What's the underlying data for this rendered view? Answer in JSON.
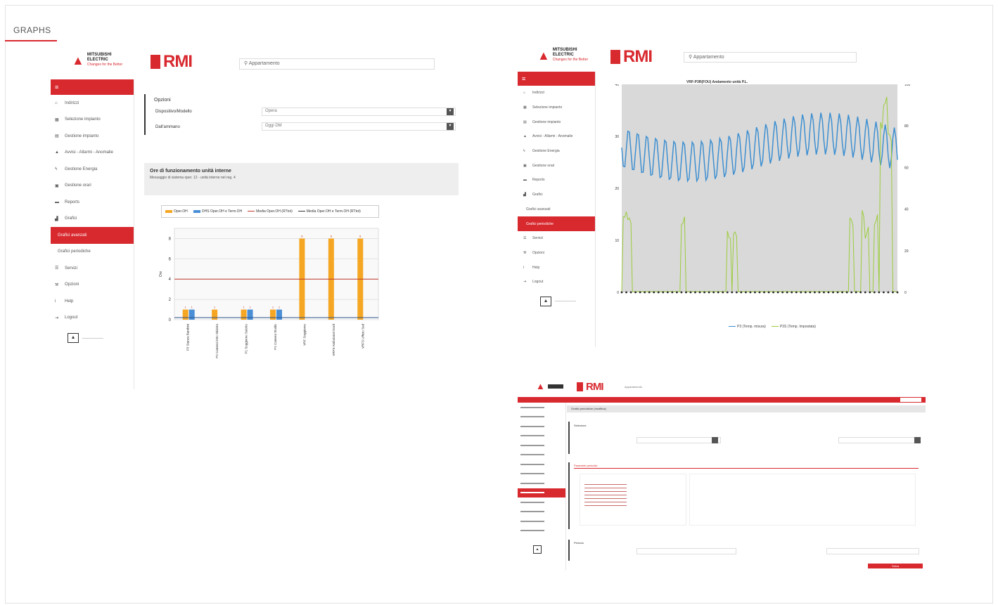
{
  "section": {
    "title": "GRAPHS"
  },
  "panel1": {
    "brand": {
      "mitsubishi_line1": "MITSUBISHI",
      "mitsubishi_line2": "ELECTRIC",
      "mitsubishi_tag": "Changes for the Better",
      "rmi": "RMI"
    },
    "search_placeholder": "Appartamento",
    "sidebar": [
      {
        "label": "Indirizzi",
        "icon": "home-icon"
      },
      {
        "label": "Selezione impianto",
        "icon": "grid-icon"
      },
      {
        "label": "Gestione impianto",
        "icon": "clipboard-icon"
      },
      {
        "label": "Avvisi - Allarmi - Anomalie",
        "icon": "warning-icon"
      },
      {
        "label": "Gestione Energia",
        "icon": "bolt-icon"
      },
      {
        "label": "Gestione orari",
        "icon": "calendar-icon"
      },
      {
        "label": "Reports",
        "icon": "folder-icon"
      },
      {
        "label": "Grafici",
        "icon": "chart-icon"
      },
      {
        "label": "Grafici avanzati",
        "icon": "",
        "active": true
      },
      {
        "label": "Grafici periodiche",
        "icon": ""
      },
      {
        "label": "Servizi",
        "icon": "list-icon"
      },
      {
        "label": "Opzioni",
        "icon": "wrench-icon"
      },
      {
        "label": "Help",
        "icon": "info-icon"
      },
      {
        "label": "Logout",
        "icon": "logout-icon"
      }
    ],
    "options": {
      "title": "Opzioni",
      "row1_label": "Dispositivo/Modello",
      "row1_value": "Opera",
      "row2_label": "Dall'ammano",
      "row2_value": "Oggi DM"
    },
    "header": {
      "title": "Ore di funzionamento unità interne",
      "subtitle": "Messaggio di sistema oper. 12 - unità interne nel reg. 4"
    },
    "legend": [
      "Oper.OH",
      "OHS Oper.OH e Term.OH",
      "Media Oper.OH (RTtot)",
      "Media Oper.OH e Term.OH (RTtot)"
    ],
    "ylabel": "Ore",
    "chart_data": {
      "type": "bar",
      "categories": [
        "P3 Stanza Bambini",
        "P2 Camera letto Sinistra",
        "P1 Soggiorno Salotto",
        "P1 Camera Studio",
        "VRF Soggiorno",
        "VRFS Ambulatori Nord",
        "VRFS Ufficio Sud"
      ],
      "series": [
        {
          "name": "Oper.OH",
          "values": [
            1,
            1,
            1,
            1,
            8,
            8,
            8
          ],
          "color": "#f5a623"
        },
        {
          "name": "OHS Oper.OH e Term.OH",
          "values": [
            1,
            0,
            1,
            1,
            0,
            0,
            0
          ],
          "color": "#4a8fd6"
        }
      ],
      "reference_line": 4,
      "ylim": [
        0,
        9
      ],
      "yticks": [
        0,
        2,
        4,
        6,
        8
      ],
      "grid": true
    }
  },
  "panel2": {
    "brand": {
      "mitsubishi_line1": "MITSUBISHI",
      "mitsubishi_line2": "ELECTRIC",
      "mitsubishi_tag": "Changes for the Better",
      "rmi": "RMI"
    },
    "search_placeholder": "Appartamento",
    "sidebar": [
      {
        "label": "Indirizzi",
        "icon": "home-icon"
      },
      {
        "label": "Selezione impianto",
        "icon": "grid-icon"
      },
      {
        "label": "Gestione impianto",
        "icon": "clipboard-icon"
      },
      {
        "label": "Avvisi - Allarmi - Anomalie",
        "icon": "warning-icon"
      },
      {
        "label": "Gestione Energia",
        "icon": "bolt-icon"
      },
      {
        "label": "Gestione orari",
        "icon": "calendar-icon"
      },
      {
        "label": "Reports",
        "icon": "folder-icon"
      },
      {
        "label": "Grafici",
        "icon": "chart-icon"
      },
      {
        "label": "Grafici avanzati",
        "icon": ""
      },
      {
        "label": "Grafici periodiche",
        "icon": "",
        "active": true
      },
      {
        "label": "Servizi",
        "icon": "list-icon"
      },
      {
        "label": "Opzioni",
        "icon": "wrench-icon"
      },
      {
        "label": "Help",
        "icon": "info-icon"
      },
      {
        "label": "Logout",
        "icon": "logout-icon"
      }
    ],
    "chart_data": {
      "type": "line",
      "title": "VRF-P3R(FOU) Andamento unità P.L.",
      "left_yticks": [
        "40",
        "30",
        "20",
        "10",
        "0"
      ],
      "right_yticks": [
        "100",
        "80",
        "60",
        "40",
        "20",
        "0"
      ],
      "series": [
        {
          "name": "P3 (Temp. misura)",
          "color": "#3d8fd1"
        },
        {
          "name": "P3S (Temp. Impostata)",
          "color": "#9ccc3c"
        }
      ]
    }
  },
  "panel3": {
    "brand": {
      "rmi": "RMI"
    },
    "search_placeholder": "Appartamento",
    "page_title": "Grafici periodiche (modifica)",
    "sections": [
      "Selezione",
      "Parametri periodici",
      "Periodo"
    ],
    "save_label": "Salva"
  }
}
